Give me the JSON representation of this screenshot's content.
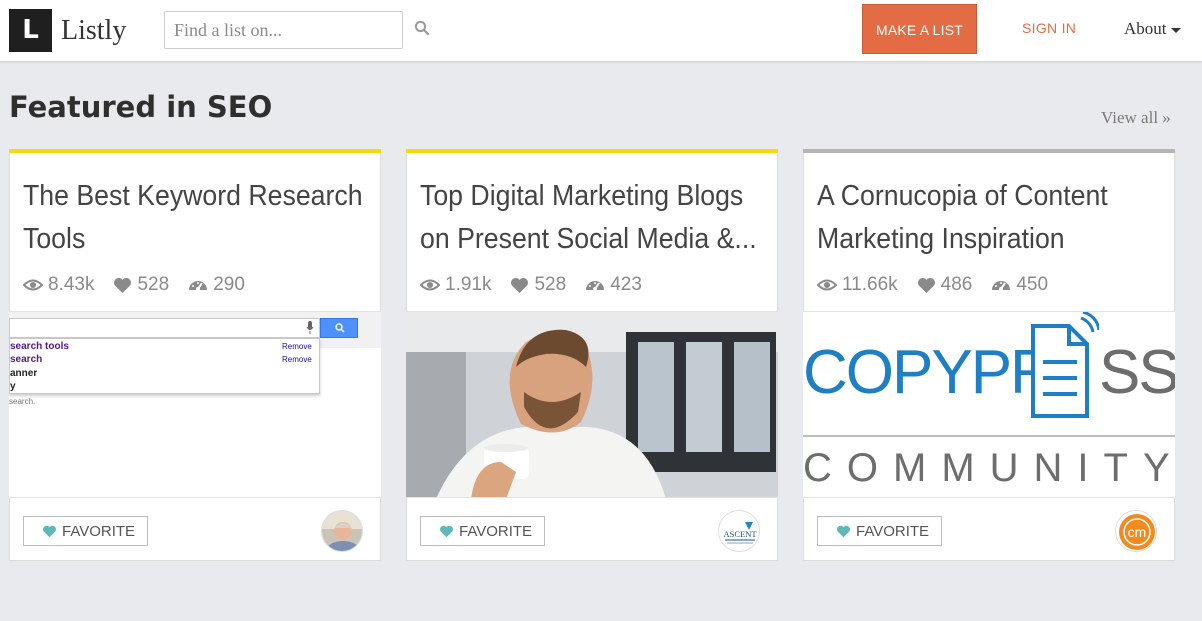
{
  "header": {
    "logo_letter": "L",
    "logo_text": "Listly",
    "search_placeholder": "Find a list on...",
    "make_list_label": "MAKE A LIST",
    "sign_in_label": "SIGN IN",
    "about_label": "About"
  },
  "section": {
    "title": "Featured in SEO",
    "view_all_label": "View all »"
  },
  "colors": {
    "brand_orange": "#e36c44",
    "accent_yellow": "#f5d90a",
    "accent_gray": "#b5b5b5",
    "heart_teal": "#5fb8b8"
  },
  "cards": [
    {
      "title": "The Best Keyword Research Tools",
      "views": "8.43k",
      "likes": "528",
      "items": "290",
      "favorite_label": "FAVORITE",
      "thumbnail": {
        "suggestions": [
          "search tools",
          "search",
          "anner",
          "y"
        ],
        "remove_label": "Remove",
        "hint": "search."
      }
    },
    {
      "title": "Top Digital Marketing Blogs on Present Social Media &...",
      "views": "1.91k",
      "likes": "528",
      "items": "423",
      "favorite_label": "FAVORITE",
      "avatar_text": "ASCENT"
    },
    {
      "title": "A Cornucopia of Content Marketing Inspiration",
      "views": "11.66k",
      "likes": "486",
      "items": "450",
      "favorite_label": "FAVORITE",
      "thumbnail": {
        "brand_left": "COPYPR",
        "brand_right": "SS",
        "community": "COMMUNITY"
      },
      "avatar_text": "cm"
    }
  ]
}
